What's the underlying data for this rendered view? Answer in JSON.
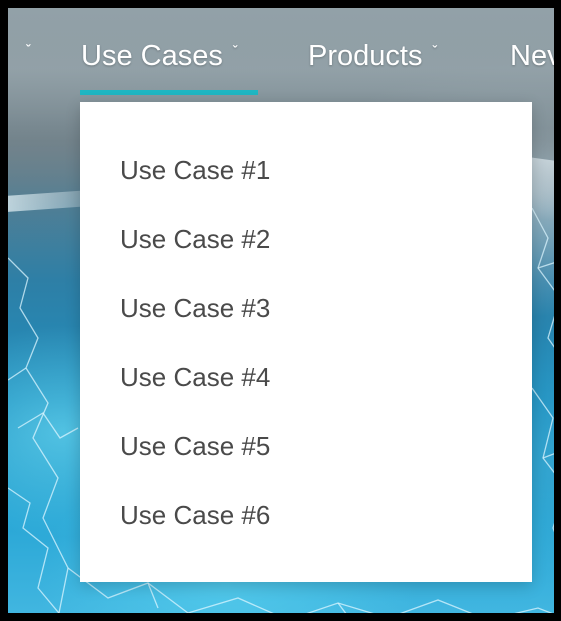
{
  "nav": {
    "items": [
      {
        "label": "Use Cases",
        "active": true
      },
      {
        "label": "Products",
        "active": false
      },
      {
        "label": "Nev",
        "active": false
      }
    ],
    "chevron_icon": "chevron-down-icon",
    "accent_color": "#1fb6c2"
  },
  "dropdown": {
    "items": [
      {
        "label": "Use Case #1"
      },
      {
        "label": "Use Case #2"
      },
      {
        "label": "Use Case #3"
      },
      {
        "label": "Use Case #4"
      },
      {
        "label": "Use Case #5"
      },
      {
        "label": "Use Case #6"
      }
    ]
  }
}
